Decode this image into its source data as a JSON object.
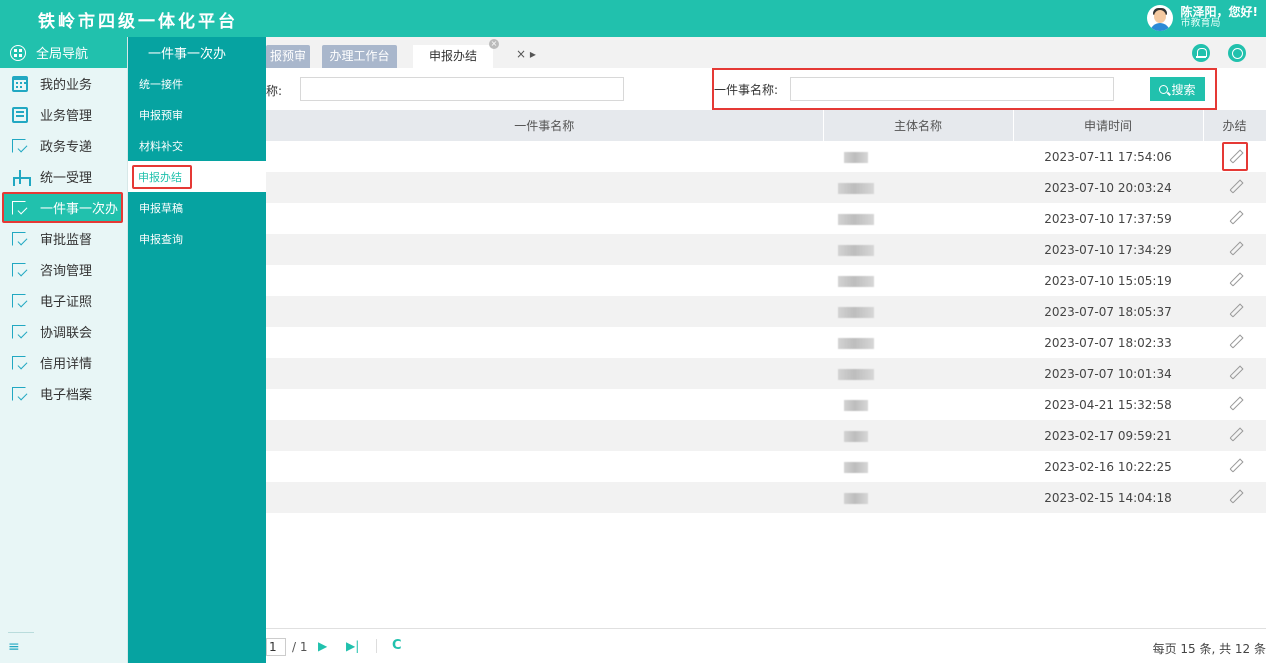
{
  "app": {
    "title": "铁岭市四级一体化平台",
    "user_greeting": "陈泽阳，您好!",
    "user_dept": "市教育局"
  },
  "leftnav": {
    "header": "全局导航",
    "items": [
      {
        "label": "我的业务",
        "icon": "calendar-icon"
      },
      {
        "label": "业务管理",
        "icon": "monitor-icon"
      },
      {
        "label": "政务专递",
        "icon": "doc-check-icon"
      },
      {
        "label": "统一受理",
        "icon": "org-tree-icon"
      },
      {
        "label": "一件事一次办",
        "icon": "doc-check-icon"
      },
      {
        "label": "审批监督",
        "icon": "doc-check-icon"
      },
      {
        "label": "咨询管理",
        "icon": "doc-check-icon"
      },
      {
        "label": "电子证照",
        "icon": "doc-check-icon"
      },
      {
        "label": "协调联会",
        "icon": "doc-check-icon"
      },
      {
        "label": "信用详情",
        "icon": "doc-check-icon"
      },
      {
        "label": "电子档案",
        "icon": "doc-check-icon"
      }
    ],
    "collapse_icon": "≡"
  },
  "subnav": {
    "header": "一件事一次办",
    "items": [
      "统一接件",
      "申报预审",
      "材料补交",
      "申报办结",
      "申报草稿",
      "申报查询"
    ]
  },
  "tabs": {
    "items": [
      "报预审",
      "办理工作台",
      "申报办结"
    ],
    "close_glyph": "×",
    "ctrl": "×  ▸"
  },
  "search": {
    "label1": "称:",
    "label2": "一件事名称:",
    "button": "搜索"
  },
  "table": {
    "headers": [
      "一件事名称",
      "主体名称",
      "申请时间",
      "办结"
    ],
    "rows": [
      {
        "time": "2023-07-11 17:54:06"
      },
      {
        "time": "2023-07-10 20:03:24"
      },
      {
        "time": "2023-07-10 17:37:59"
      },
      {
        "time": "2023-07-10 17:34:29"
      },
      {
        "time": "2023-07-10 15:05:19"
      },
      {
        "time": "2023-07-07 18:05:37"
      },
      {
        "time": "2023-07-07 18:02:33"
      },
      {
        "time": "2023-07-07 10:01:34"
      },
      {
        "time": "2023-04-21 15:32:58"
      },
      {
        "time": "2023-02-17 09:59:21"
      },
      {
        "time": "2023-02-16 10:22:25"
      },
      {
        "time": "2023-02-15 14:04:18"
      }
    ]
  },
  "pager": {
    "page": "1",
    "total": "/ 1",
    "next": "▶",
    "last": "▶|",
    "refresh": "C",
    "summary": "每页 15 条, 共 12 条"
  },
  "colors": {
    "accent": "#21c1ad",
    "subnav": "#06a3a1",
    "highlight": "#e53935"
  }
}
